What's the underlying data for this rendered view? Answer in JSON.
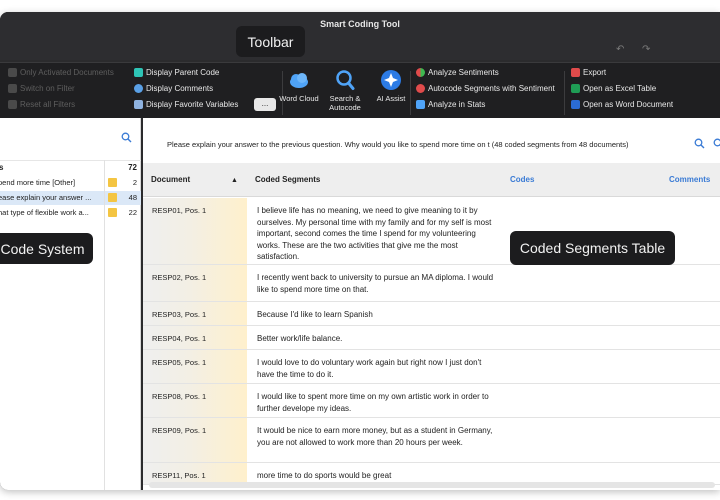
{
  "window": {
    "title": "Smart Coding Tool"
  },
  "ribbon": {
    "filters": [
      {
        "label": "Only Activated Documents"
      },
      {
        "label": "Switch on Filter"
      },
      {
        "label": "Reset all Filters"
      }
    ],
    "display": [
      {
        "label": "Display Parent Code"
      },
      {
        "label": "Display Comments"
      },
      {
        "label": "Display Favorite Variables"
      }
    ],
    "more_button": "...",
    "big_buttons": [
      {
        "label": "Word Cloud",
        "icon": "cloud-icon"
      },
      {
        "label": "Search & Autocode",
        "icon": "search-icon"
      },
      {
        "label": "AI Assist",
        "icon": "ai-assist-icon"
      }
    ],
    "analysis": [
      {
        "label": "Analyze Sentiments"
      },
      {
        "label": "Autocode Segments with Sentiment"
      },
      {
        "label": "Analyze in Stats"
      }
    ],
    "export": [
      {
        "label": "Export"
      },
      {
        "label": "Open as Excel Table"
      },
      {
        "label": "Open as Word Document"
      }
    ]
  },
  "callouts": {
    "toolbar": "Toolbar",
    "code_system": "Code System",
    "segments_table": "Coded Segments Table"
  },
  "code_system": {
    "header": {
      "label": "s",
      "count": "72"
    },
    "rows": [
      {
        "label": "pend more time [Other]",
        "count": "2"
      },
      {
        "label": "ease explain your answer ...",
        "count": "48"
      },
      {
        "label": "hat type of flexible work a...",
        "count": "22"
      }
    ]
  },
  "segments": {
    "description": "Please explain your answer to the previous question. Why would you like to spend more time on t (48 coded segments from 48 documents)",
    "columns": {
      "document": "Document",
      "segment": "Coded Segments",
      "codes": "Codes",
      "comments": "Comments"
    },
    "rows": [
      {
        "doc": "RESP01, Pos. 1",
        "text": "I believe life has no meaning, we need to give meaning to it by ourselves. My personal time with my family and for my self is most important, second comes the time I spend for my volunteering works. These are the two activities that give me the most satisfaction."
      },
      {
        "doc": "RESP02, Pos. 1",
        "text": "I recently went back to university to pursue an MA diploma. I would like to spend more time on that."
      },
      {
        "doc": "RESP03, Pos. 1",
        "text": "Because I'd like to learn Spanish"
      },
      {
        "doc": "RESP04, Pos. 1",
        "text": "Better work/life balance."
      },
      {
        "doc": "RESP05, Pos. 1",
        "text": "I would love to do voluntary work again but right now I just don't have the time to do it."
      },
      {
        "doc": "RESP08, Pos. 1",
        "text": "I would like to spent more time on my own artistic work in order to further develope my ideas."
      },
      {
        "doc": "RESP09, Pos. 1",
        "text": "It would be nice to earn more money, but as a student in Germany, you are not allowed to work more than 20 hours per week."
      },
      {
        "doc": "RESP11, Pos. 1",
        "text": "more time to do sports would be great"
      }
    ]
  }
}
